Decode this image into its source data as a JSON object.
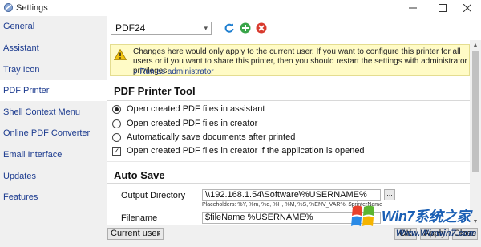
{
  "window": {
    "title": "Settings",
    "minimize_icon": "minimize-icon",
    "maximize_icon": "maximize-icon",
    "close_icon": "close-icon"
  },
  "sidebar": {
    "items": [
      {
        "label": "General"
      },
      {
        "label": "Assistant"
      },
      {
        "label": "Tray Icon"
      },
      {
        "label": "PDF Printer",
        "selected": true
      },
      {
        "label": "Shell Context Menu"
      },
      {
        "label": "Online PDF Converter"
      },
      {
        "label": "Email Interface"
      },
      {
        "label": "Updates"
      },
      {
        "label": "Features"
      }
    ]
  },
  "printer": {
    "selected": "PDF24",
    "refresh_icon": "refresh-icon",
    "add_icon": "add-icon",
    "delete_icon": "delete-icon"
  },
  "notice": {
    "icon": "warning-icon",
    "text": "Changes here would only apply to the current user. If you want to configure this printer for all users or if you want to share this printer, then you should restart the settings with administrator privileges.",
    "link": "» Run as administrator"
  },
  "pdf_printer_tool": {
    "title": "PDF Printer Tool",
    "options": [
      {
        "label": "Open created PDF files in assistant",
        "type": "radio",
        "checked": true
      },
      {
        "label": "Open created PDF files in creator",
        "type": "radio",
        "checked": false
      },
      {
        "label": "Automatically save documents after printed",
        "type": "radio",
        "checked": false
      },
      {
        "label": "Open created PDF files in creator if the application is opened",
        "type": "checkbox",
        "checked": true
      }
    ]
  },
  "auto_save": {
    "title": "Auto Save",
    "output_directory_label": "Output Directory",
    "output_directory_value": "\\\\192.168.1.54\\Software\\%USERNAME%",
    "browse_label": "...",
    "placeholders_help": "Placeholders: %Y, %m, %d, %H, %M, %S, %ENV_VAR%, $printerName",
    "filename_label": "Filename",
    "filename_value": "$fileName %USERNAME%"
  },
  "footer": {
    "scope": "Current user",
    "ok_label": "OK",
    "apply_label": "Apply",
    "close_label": "Close"
  },
  "watermark": {
    "brand": "Win7系统之家",
    "url": "Www.Winwin7.com"
  },
  "colors": {
    "accent": "#1c3b8f",
    "notice_bg": "#fffbc6",
    "sidebar_bg": "#f0f0f0"
  }
}
